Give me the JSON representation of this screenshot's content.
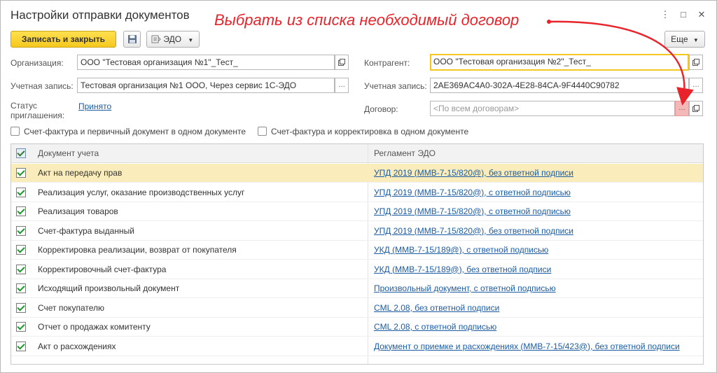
{
  "window": {
    "title": "Настройки отправки документов",
    "annotation": "Выбрать из списка необходимый договор",
    "annotation_color": "#e8232a",
    "controls": {
      "menu": "⋮",
      "minimize": "□",
      "close": "✕"
    }
  },
  "toolbar": {
    "save_close_label": "Записать и закрыть",
    "save_icon": "floppy-disk-icon",
    "edo_label": "ЭДО",
    "edo_icon": "edo-icon",
    "more_label": "Еще"
  },
  "form": {
    "organization_label": "Организация:",
    "organization_value": "ООО \"Тестовая организация №1\"_Тест_",
    "account_label": "Учетная запись:",
    "account_value": "Тестовая организация №1 ООО, Через сервис 1С-ЭДО",
    "status_label_line1": "Статус",
    "status_label_line2": "приглашения:",
    "status_value": "Принято",
    "counterparty_label": "Контрагент:",
    "counterparty_value": "ООО \"Тестовая организация №2\"_Тест_",
    "cp_account_label": "Учетная запись:",
    "cp_account_value": "2AE369AC4A0-302A-4E28-84CA-9F4440C90782",
    "contract_label": "Договор:",
    "contract_placeholder": "<По всем договорам>",
    "checkbox1_label": "Счет-фактура и первичный документ в одном документе",
    "checkbox2_label": "Счет-фактура и корректировка в одном документе",
    "checkbox1_checked": false,
    "checkbox2_checked": false
  },
  "table": {
    "col_document": "Документ учета",
    "col_regulation": "Регламент ЭДО",
    "rows": [
      {
        "document": "Акт на передачу прав",
        "regulation": "УПД 2019 (ММВ-7-15/820@), без ответной подписи",
        "checked": true,
        "selected": true
      },
      {
        "document": "Реализация услуг, оказание производственных услуг",
        "regulation": "УПД 2019 (ММВ-7-15/820@), с ответной подписью",
        "checked": true,
        "selected": false
      },
      {
        "document": "Реализация товаров",
        "regulation": "УПД 2019 (ММВ-7-15/820@), с ответной подписью",
        "checked": true,
        "selected": false
      },
      {
        "document": "Счет-фактура выданный",
        "regulation": "УПД 2019 (ММВ-7-15/820@), без ответной подписи",
        "checked": true,
        "selected": false
      },
      {
        "document": "Корректировка реализации, возврат от покупателя",
        "regulation": "УКД (ММВ-7-15/189@), с ответной подписью",
        "checked": true,
        "selected": false
      },
      {
        "document": "Корректировочный счет-фактура",
        "regulation": "УКД (ММВ-7-15/189@), без ответной подписи",
        "checked": true,
        "selected": false
      },
      {
        "document": "Исходящий произвольный документ",
        "regulation": "Произвольный документ, с ответной подписью",
        "checked": true,
        "selected": false
      },
      {
        "document": "Счет покупателю",
        "regulation": "CML 2.08, без ответной подписи",
        "checked": true,
        "selected": false
      },
      {
        "document": "Отчет о продажах комитенту",
        "regulation": "CML 2.08, с ответной подписью",
        "checked": true,
        "selected": false
      },
      {
        "document": "Акт о расхождениях",
        "regulation": "Документ о приемке и расхождениях (ММВ-7-15/423@), без ответной подписи",
        "checked": true,
        "selected": false
      }
    ]
  }
}
